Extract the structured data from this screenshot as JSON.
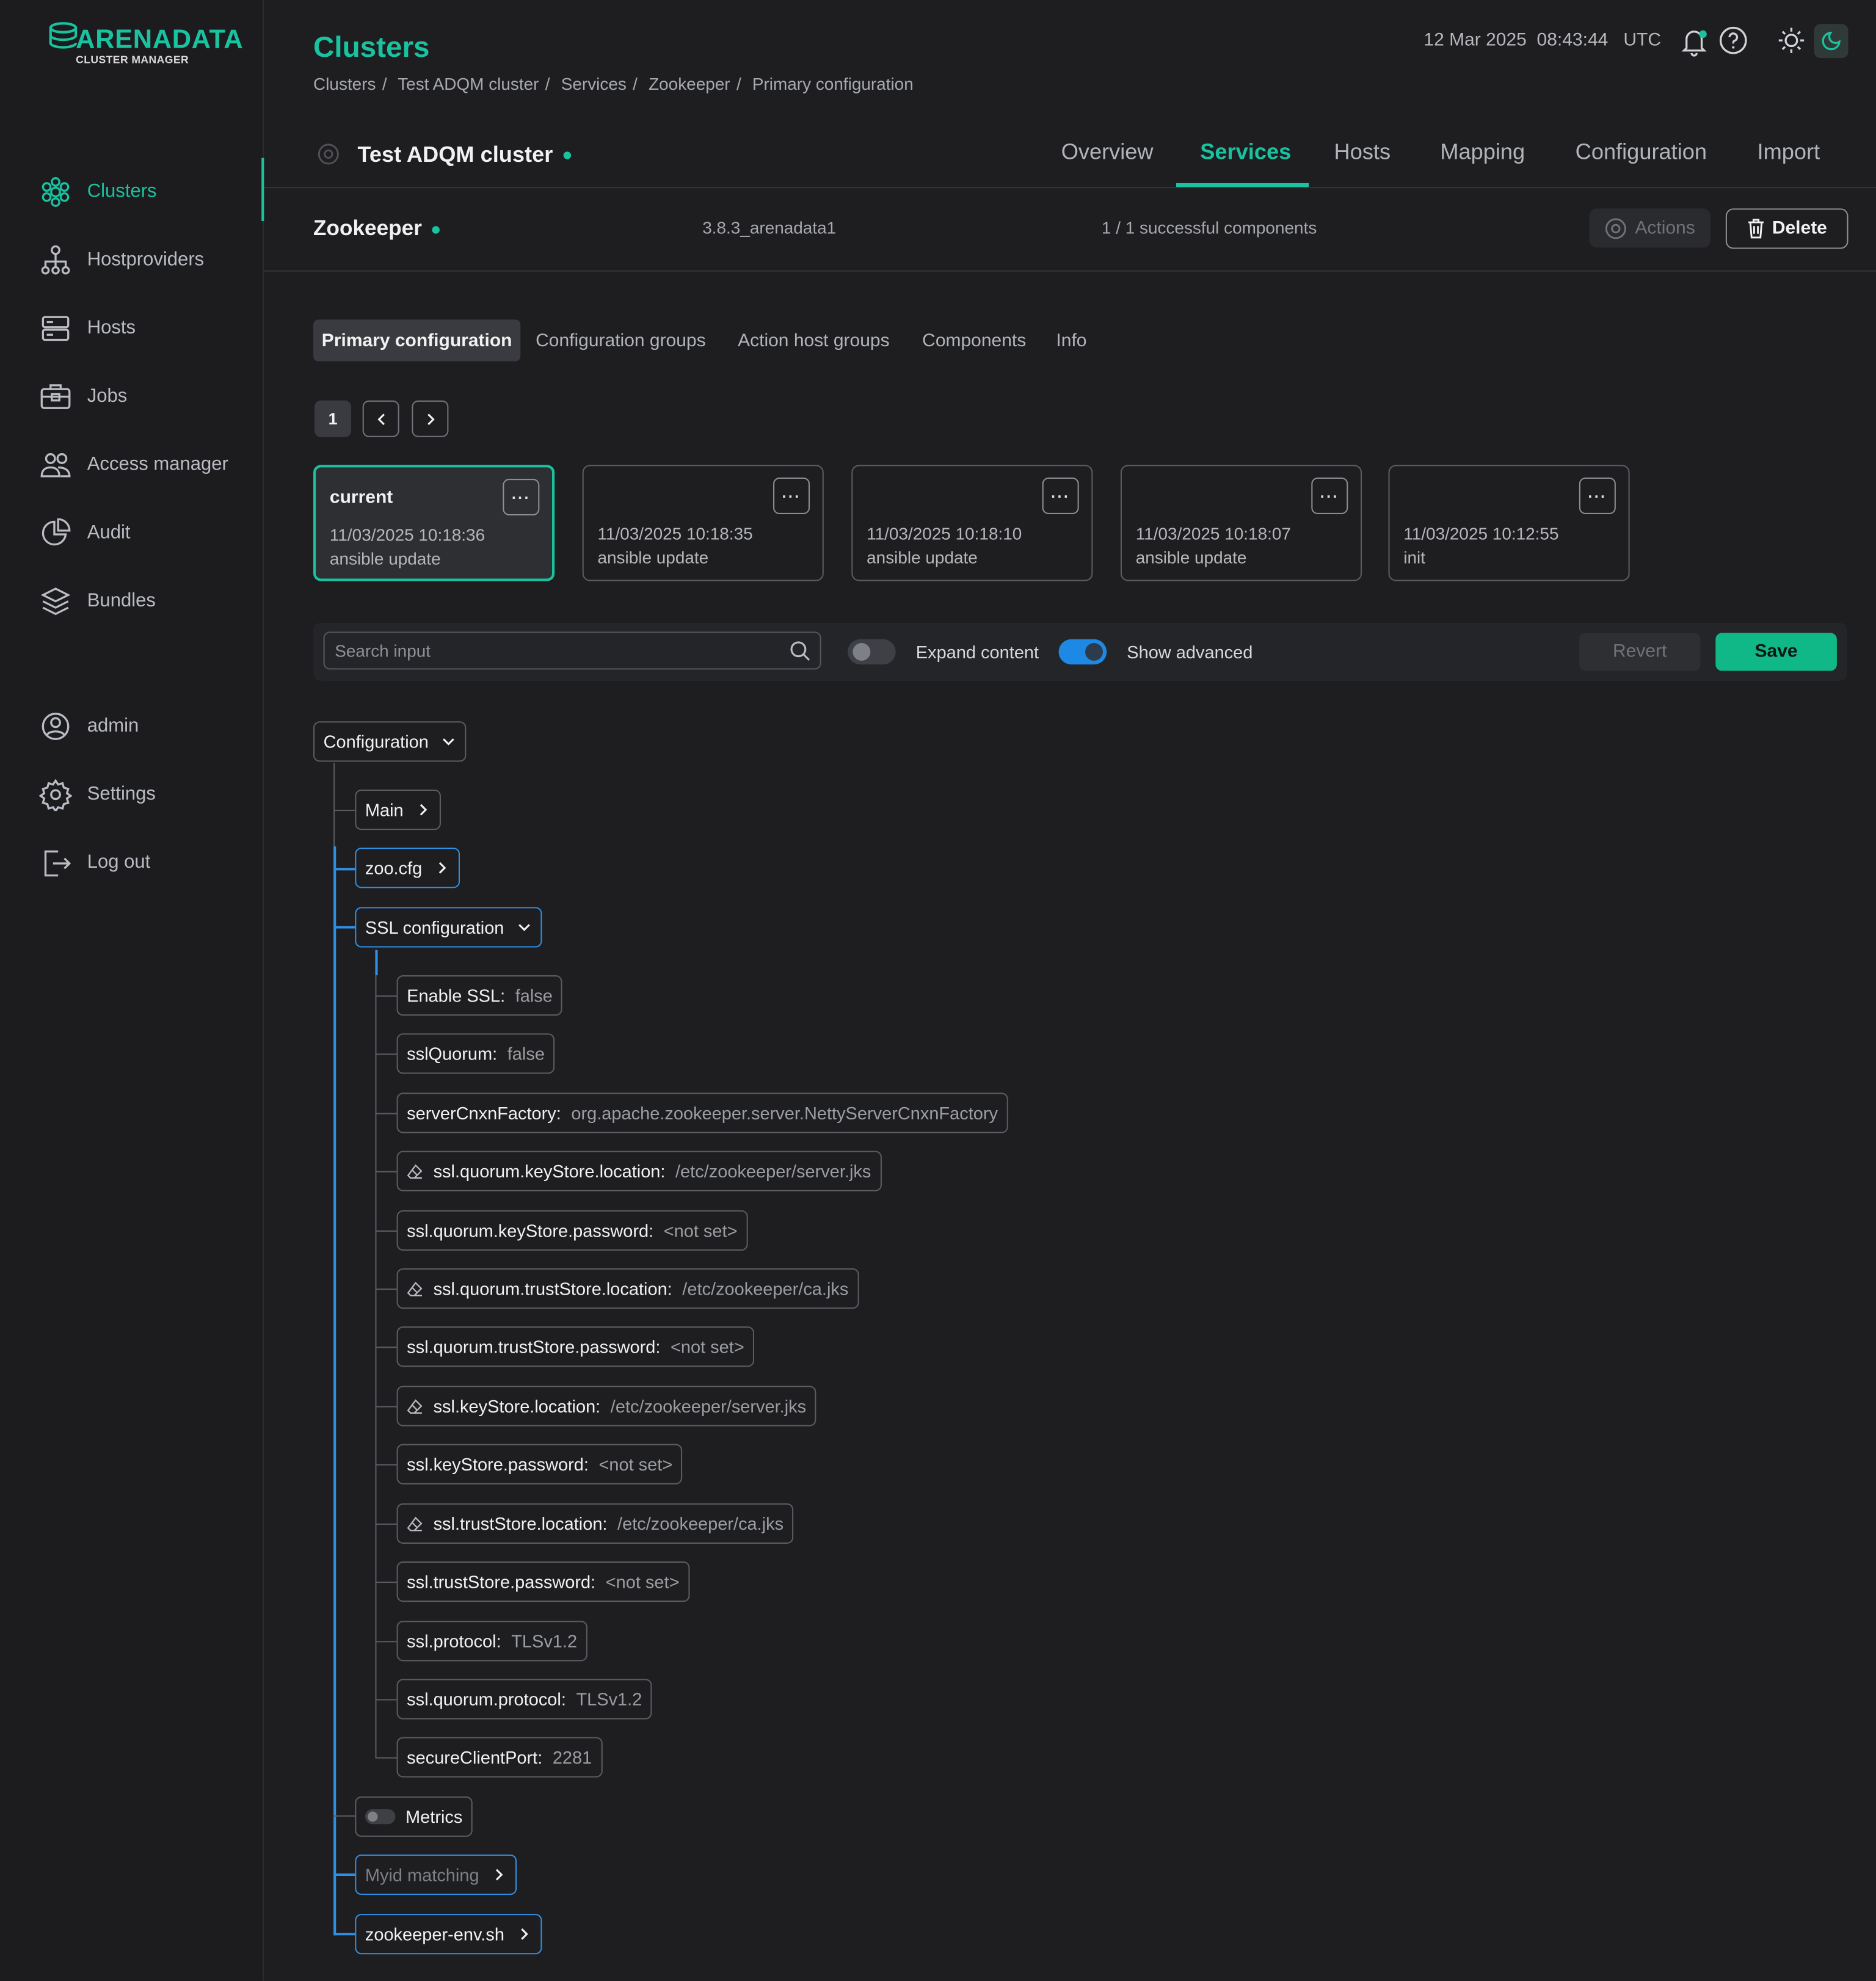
{
  "app": {
    "logo_main": "ARENADATA",
    "logo_sub": "CLUSTER MANAGER",
    "accent_color": "#19c3a0",
    "save_color": "#0fb886",
    "tree_highlight_color": "#2f8fe6"
  },
  "sidebar": {
    "items": [
      {
        "label": "Clusters",
        "icon": "clusters-icon",
        "active": true
      },
      {
        "label": "Hostproviders",
        "icon": "hostproviders-icon"
      },
      {
        "label": "Hosts",
        "icon": "hosts-icon"
      },
      {
        "label": "Jobs",
        "icon": "jobs-icon"
      },
      {
        "label": "Access manager",
        "icon": "access-manager-icon"
      },
      {
        "label": "Audit",
        "icon": "audit-icon"
      },
      {
        "label": "Bundles",
        "icon": "bundles-icon"
      }
    ],
    "bottom": [
      {
        "label": "admin",
        "icon": "user-icon"
      },
      {
        "label": "Settings",
        "icon": "settings-icon"
      },
      {
        "label": "Log out",
        "icon": "logout-icon"
      }
    ]
  },
  "header": {
    "title": "Clusters",
    "breadcrumbs": [
      "Clusters",
      "Test ADQM cluster",
      "Services",
      "Zookeeper",
      "Primary configuration"
    ],
    "date": "12 Mar 2025",
    "time": "08:43:44",
    "tz": "UTC"
  },
  "cluster": {
    "name": "Test ADQM cluster",
    "tabs": [
      "Overview",
      "Services",
      "Hosts",
      "Mapping",
      "Configuration",
      "Import"
    ],
    "active_tab": "Services"
  },
  "service": {
    "name": "Zookeeper",
    "version": "3.8.3_arenadata1",
    "components_status": "1 / 1 successful components",
    "actions_label": "Actions",
    "delete_label": "Delete"
  },
  "subtabs": [
    "Primary configuration",
    "Configuration groups",
    "Action host groups",
    "Components",
    "Info"
  ],
  "pagination": {
    "page": "1"
  },
  "versions": [
    {
      "label": "current",
      "date": "11/03/2025 10:18:36",
      "desc": "ansible update",
      "menu": "···"
    },
    {
      "label": "",
      "date": "11/03/2025 10:18:35",
      "desc": "ansible update",
      "menu": "···"
    },
    {
      "label": "",
      "date": "11/03/2025 10:18:10",
      "desc": "ansible update",
      "menu": "···"
    },
    {
      "label": "",
      "date": "11/03/2025 10:18:07",
      "desc": "ansible update",
      "menu": "···"
    },
    {
      "label": "",
      "date": "11/03/2025 10:12:55",
      "desc": "init",
      "menu": "···"
    }
  ],
  "toolbar": {
    "search_placeholder": "Search input",
    "expand_label": "Expand content",
    "expand_on": false,
    "advanced_label": "Show advanced",
    "advanced_on": true,
    "revert_label": "Revert",
    "save_label": "Save"
  },
  "tree": {
    "root": "Configuration",
    "main": "Main",
    "zoo_cfg": "zoo.cfg",
    "ssl": "SSL configuration",
    "ssl_fields": [
      {
        "key": "Enable SSL:",
        "value": "false"
      },
      {
        "key": "sslQuorum:",
        "value": "false"
      },
      {
        "key": "serverCnxnFactory:",
        "value": "org.apache.zookeeper.server.NettyServerCnxnFactory"
      },
      {
        "key": "ssl.quorum.keyStore.location:",
        "value": "/etc/zookeeper/server.jks",
        "icon": "eraser-icon"
      },
      {
        "key": "ssl.quorum.keyStore.password:",
        "value": "<not set>"
      },
      {
        "key": "ssl.quorum.trustStore.location:",
        "value": "/etc/zookeeper/ca.jks",
        "icon": "eraser-icon"
      },
      {
        "key": "ssl.quorum.trustStore.password:",
        "value": "<not set>"
      },
      {
        "key": "ssl.keyStore.location:",
        "value": "/etc/zookeeper/server.jks",
        "icon": "eraser-icon"
      },
      {
        "key": "ssl.keyStore.password:",
        "value": "<not set>"
      },
      {
        "key": "ssl.trustStore.location:",
        "value": "/etc/zookeeper/ca.jks",
        "icon": "eraser-icon"
      },
      {
        "key": "ssl.trustStore.password:",
        "value": "<not set>"
      },
      {
        "key": "ssl.protocol:",
        "value": "TLSv1.2"
      },
      {
        "key": "ssl.quorum.protocol:",
        "value": "TLSv1.2"
      },
      {
        "key": "secureClientPort:",
        "value": "2281"
      }
    ],
    "metrics": "Metrics",
    "myid": "Myid matching",
    "env": "zookeeper-env.sh"
  }
}
